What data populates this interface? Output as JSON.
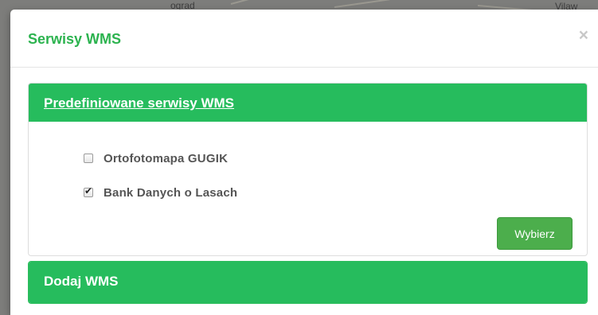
{
  "background": {
    "map_labels": [
      "ograd",
      "Vilaw"
    ]
  },
  "modal": {
    "title": "Serwisy WMS",
    "close_glyph": "×",
    "panels": [
      {
        "title": "Predefiniowane serwisy WMS",
        "options": [
          {
            "label": "Ortofotomapa GUGIK",
            "checked": false
          },
          {
            "label": "Bank Danych o Lasach",
            "checked": true
          }
        ],
        "button_label": "Wybierz"
      },
      {
        "title": "Dodaj WMS"
      }
    ]
  },
  "colors": {
    "accent_green": "#26bc5d",
    "title_green": "#2cb34f",
    "button_green": "#4cae4c"
  },
  "icons": {
    "close": "close-icon",
    "check": "checkmark-icon"
  }
}
